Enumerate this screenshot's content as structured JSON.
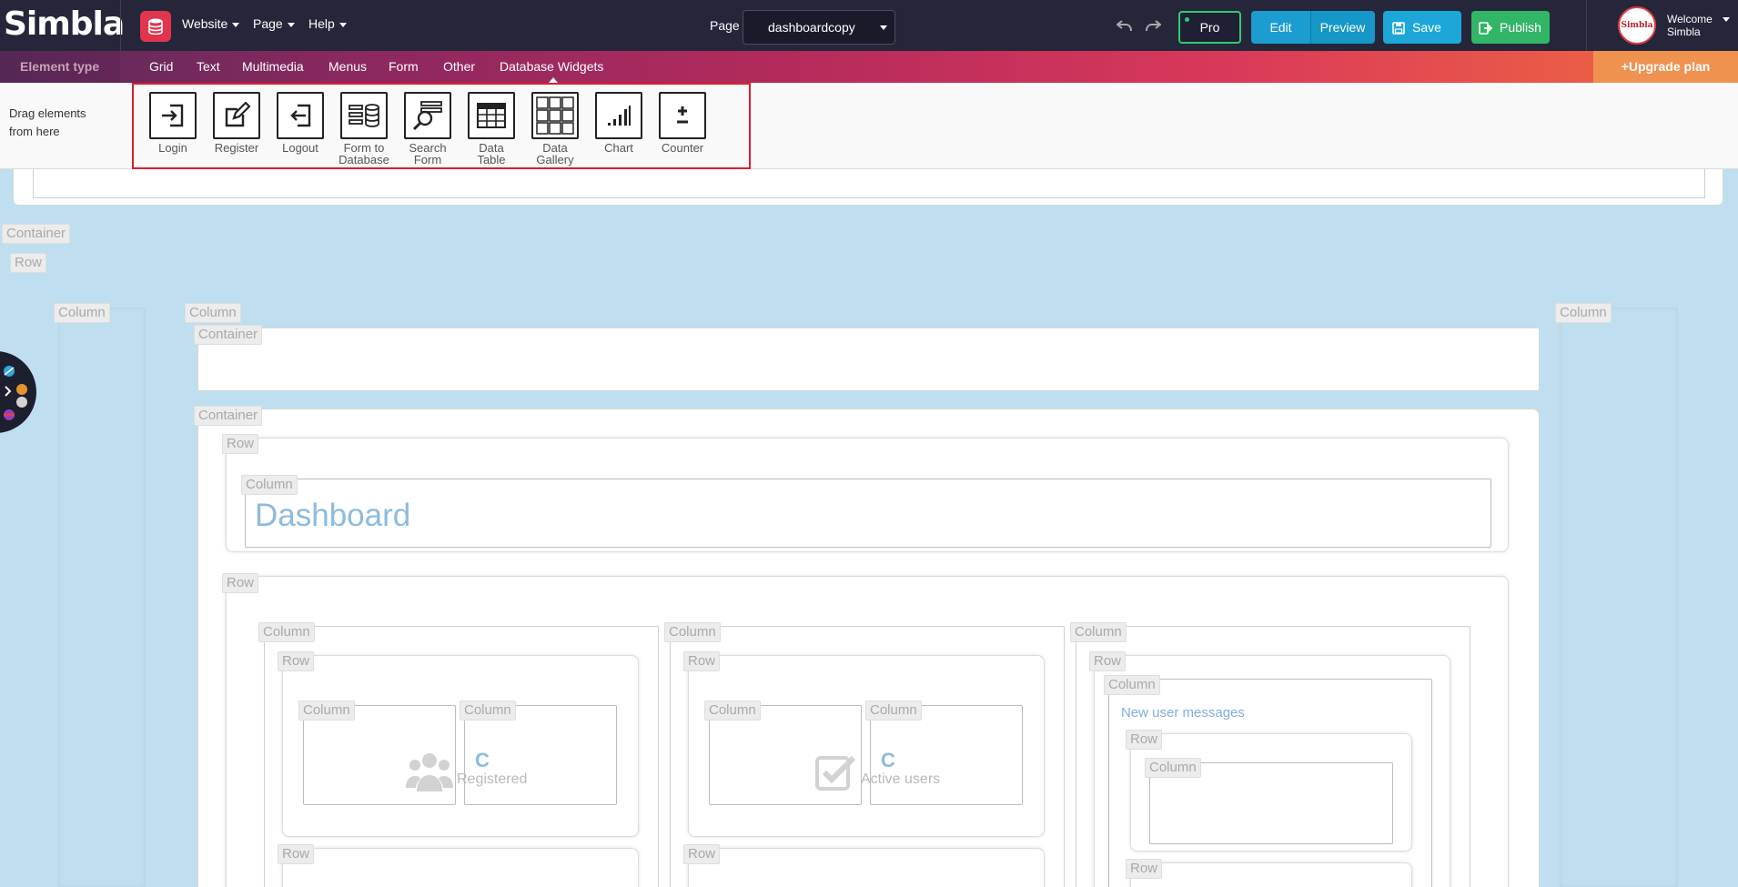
{
  "topbar": {
    "logo": "Simbla",
    "menus": [
      {
        "label": "Website"
      },
      {
        "label": "Page"
      },
      {
        "label": "Help"
      }
    ],
    "page_label": "Page",
    "page_value": "dashboardcopy",
    "pro_label": "Pro",
    "edit_label": "Edit",
    "preview_label": "Preview",
    "save_label": "Save",
    "publish_label": "Publish",
    "welcome_line1": "Welcome",
    "welcome_line2": "Simbla",
    "avatar_text": "Simbla"
  },
  "typebar": {
    "label": "Element type",
    "items": [
      {
        "label": "Grid"
      },
      {
        "label": "Text"
      },
      {
        "label": "Multimedia"
      },
      {
        "label": "Menus"
      },
      {
        "label": "Form"
      },
      {
        "label": "Other"
      },
      {
        "label": "Database Widgets"
      }
    ],
    "upgrade": "+Upgrade plan"
  },
  "drawer": {
    "hint": "Drag elements from here",
    "widgets": [
      {
        "label": "Login",
        "icon": "login-icon"
      },
      {
        "label": "Register",
        "icon": "register-icon"
      },
      {
        "label": "Logout",
        "icon": "logout-icon"
      },
      {
        "label": "Form to Database",
        "icon": "form-to-database-icon"
      },
      {
        "label": "Search Form",
        "icon": "search-form-icon"
      },
      {
        "label": "Data Table",
        "icon": "data-table-icon"
      },
      {
        "label": "Data Gallery",
        "icon": "data-gallery-icon"
      },
      {
        "label": "Chart",
        "icon": "chart-icon"
      },
      {
        "label": "Counter",
        "icon": "counter-icon"
      }
    ]
  },
  "canvas": {
    "container": "Container",
    "row": "Row",
    "column": "Column",
    "dashboard_title": "Dashboard",
    "stats": [
      {
        "value": "C",
        "label": "Registered",
        "icon": "users-icon"
      },
      {
        "value": "C",
        "label": "Active users",
        "icon": "checkbox-icon"
      }
    ],
    "new_messages_title": "New user messages"
  },
  "colors": {
    "accent": "#1ca7d8",
    "publish": "#31b668",
    "pro_border": "#2ecc71",
    "highlight": "#e01d2d"
  }
}
